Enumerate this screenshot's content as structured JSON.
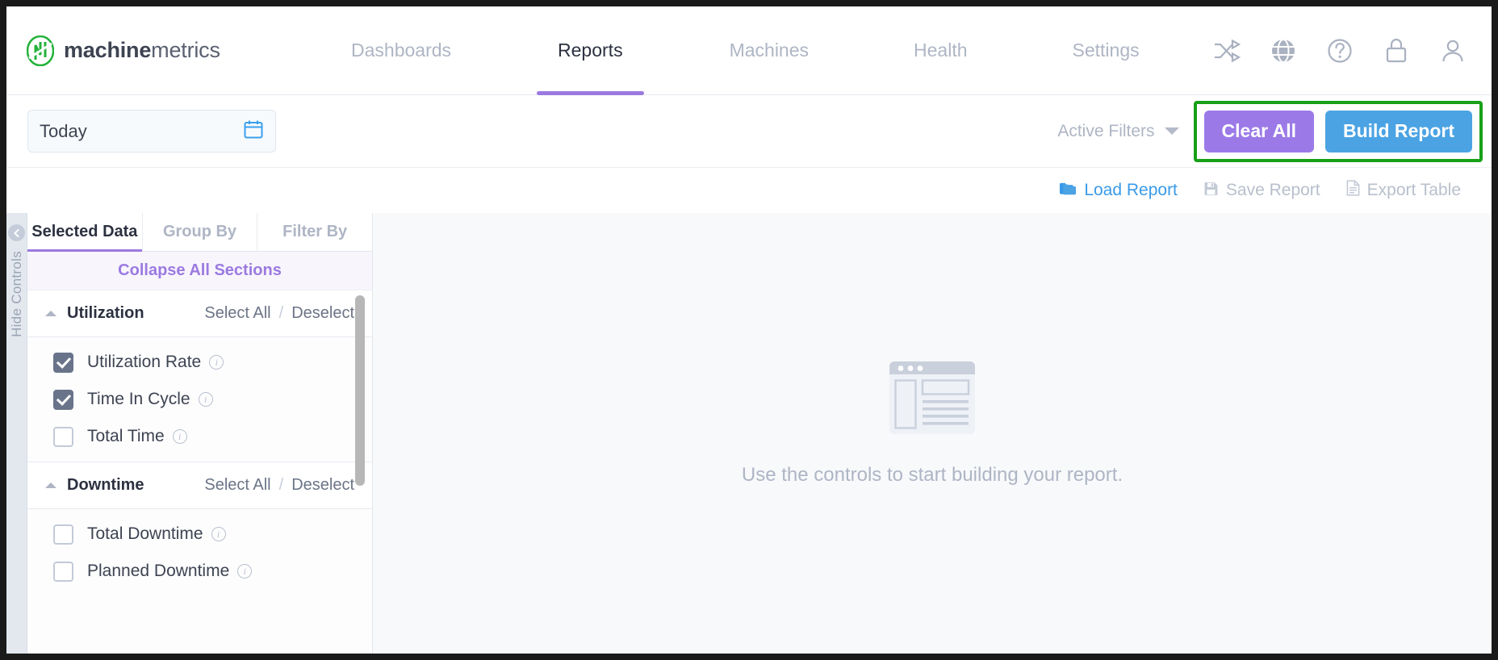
{
  "brand": {
    "bold": "machine",
    "light": "metrics",
    "logo_icon": "machinemetrics-logo-icon"
  },
  "nav": {
    "links": [
      {
        "label": "Dashboards",
        "active": false
      },
      {
        "label": "Reports",
        "active": true
      },
      {
        "label": "Machines",
        "active": false
      },
      {
        "label": "Health",
        "active": false
      },
      {
        "label": "Settings",
        "active": false
      }
    ],
    "icons": [
      "shuffle-icon",
      "globe-icon",
      "help-icon",
      "lock-icon",
      "user-icon"
    ]
  },
  "filter_bar": {
    "date_range_value": "Today",
    "calendar_icon": "calendar-icon",
    "active_filters_label": "Active Filters",
    "clear_all_label": "Clear All",
    "build_report_label": "Build Report",
    "highlight_color": "#18a018",
    "clear_all_color": "#9b7ae8",
    "build_report_color": "#4ba3e3"
  },
  "actions": [
    {
      "label": "Load Report",
      "icon": "folder-icon",
      "state": "enabled"
    },
    {
      "label": "Save Report",
      "icon": "save-disk-icon",
      "state": "disabled"
    },
    {
      "label": "Export Table",
      "icon": "document-icon",
      "state": "disabled"
    }
  ],
  "hide_controls": {
    "label": "Hide Controls",
    "icon": "chevron-left-circle-icon"
  },
  "panel": {
    "tabs": [
      {
        "label": "Selected Data",
        "active": true
      },
      {
        "label": "Group By",
        "active": false
      },
      {
        "label": "Filter By",
        "active": false
      }
    ],
    "collapse_all_label": "Collapse All Sections",
    "select_all_label": "Select All",
    "deselect_label": "Deselect",
    "separator": "/",
    "sections": [
      {
        "title": "Utilization",
        "options": [
          {
            "label": "Utilization Rate",
            "checked": true
          },
          {
            "label": "Time In Cycle",
            "checked": true
          },
          {
            "label": "Total Time",
            "checked": false
          }
        ]
      },
      {
        "title": "Downtime",
        "options": [
          {
            "label": "Total Downtime",
            "checked": false
          },
          {
            "label": "Planned Downtime",
            "checked": false
          }
        ]
      }
    ]
  },
  "main": {
    "empty_illustration": "report-placeholder-icon",
    "empty_text": "Use the controls to start building your report."
  }
}
